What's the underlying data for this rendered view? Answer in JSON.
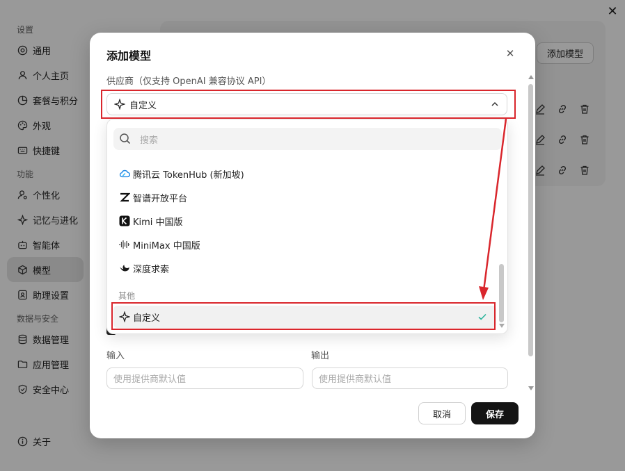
{
  "sidebar": {
    "sections": [
      {
        "title": "设置",
        "items": [
          {
            "label": "通用",
            "icon": "settings-icon"
          },
          {
            "label": "个人主页",
            "icon": "user-icon"
          },
          {
            "label": "套餐与积分",
            "icon": "pie-chart-icon"
          },
          {
            "label": "外观",
            "icon": "palette-icon"
          },
          {
            "label": "快捷键",
            "icon": "keyboard-icon"
          }
        ]
      },
      {
        "title": "功能",
        "items": [
          {
            "label": "个性化",
            "icon": "user-cog-icon"
          },
          {
            "label": "记忆与进化",
            "icon": "sparkle-icon"
          },
          {
            "label": "智能体",
            "icon": "robot-icon"
          },
          {
            "label": "模型",
            "icon": "cube-icon",
            "active": true
          },
          {
            "label": "助理设置",
            "icon": "assistant-icon"
          }
        ]
      },
      {
        "title": "数据与安全",
        "items": [
          {
            "label": "数据管理",
            "icon": "database-icon"
          },
          {
            "label": "应用管理",
            "icon": "folder-icon"
          },
          {
            "label": "安全中心",
            "icon": "shield-icon"
          }
        ]
      }
    ],
    "footer_item": {
      "label": "关于",
      "icon": "info-icon"
    }
  },
  "background": {
    "add_model_label": "添加模型"
  },
  "modal": {
    "title": "添加模型",
    "provider_label": "供应商（仅支持 OpenAI 兼容协议 API）",
    "provider_value": "自定义",
    "input_label": "输入",
    "output_label": "输出",
    "input_placeholder": "使用提供商默认值",
    "output_placeholder": "使用提供商默认值",
    "cancel_label": "取消",
    "save_label": "保存"
  },
  "dropdown": {
    "search_placeholder": "搜索",
    "items": [
      {
        "label": "腾讯云 TokenHub (新加坡)",
        "icon": "tencent-cloud-icon"
      },
      {
        "label": "智谱开放平台",
        "icon": "zhipu-icon"
      },
      {
        "label": "Kimi 中国版",
        "icon": "kimi-icon"
      },
      {
        "label": "MiniMax 中国版",
        "icon": "minimax-icon"
      },
      {
        "label": "深度求索",
        "icon": "deepseek-icon"
      }
    ],
    "group_other": "其他",
    "selected_item": {
      "label": "自定义",
      "icon": "sparkle-icon",
      "checked": true
    }
  },
  "colors": {
    "annotation_red": "#d9262c",
    "check_green": "#2bb39b",
    "save_bg": "#141414"
  }
}
